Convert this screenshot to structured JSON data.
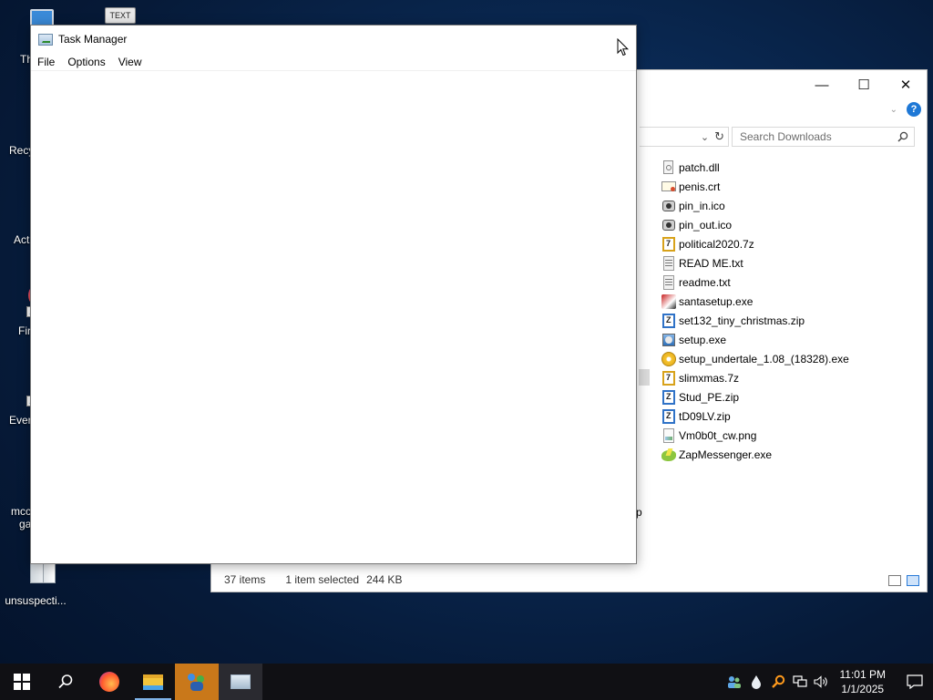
{
  "desktop": {
    "icons": [
      {
        "label": "Th",
        "icon": "this-pc-icon"
      },
      {
        "label": "TEXT",
        "icon": "text-document-icon"
      },
      {
        "label": "Recy",
        "icon": "recycle-bin-icon"
      },
      {
        "label": "Act",
        "icon": "document-icon"
      },
      {
        "label": "Fir",
        "icon": "firefox-icon"
      },
      {
        "label": "Ever",
        "icon": "everything-icon"
      },
      {
        "label": "mcc",
        "label2": "ga",
        "icon": "document-icon"
      },
      {
        "label": "unsuspecti...",
        "icon": "document-icon"
      }
    ]
  },
  "task_manager": {
    "title": "Task Manager",
    "menu": [
      "File",
      "Options",
      "View"
    ]
  },
  "explorer": {
    "caption": {
      "minimize": "—",
      "maximize": "☐",
      "close": "✕"
    },
    "search_placeholder": "Search Downloads",
    "files": [
      {
        "name": "patch.dll",
        "icon": "dll-icon"
      },
      {
        "name": "penis.crt",
        "icon": "certificate-icon"
      },
      {
        "name": "pin_in.ico",
        "icon": "ico-file-icon"
      },
      {
        "name": "pin_out.ico",
        "icon": "ico-file-icon"
      },
      {
        "name": "political2020.7z",
        "icon": "archive-7z-icon"
      },
      {
        "name": "READ ME.txt",
        "icon": "text-file-icon"
      },
      {
        "name": "readme.txt",
        "icon": "text-file-icon"
      },
      {
        "name": "santasetup.exe",
        "icon": "santa-exe-icon"
      },
      {
        "name": "set132_tiny_christmas.zip",
        "icon": "archive-zip-icon"
      },
      {
        "name": "setup.exe",
        "icon": "setup-exe-icon"
      },
      {
        "name": "setup_undertale_1.08_(18328).exe",
        "icon": "disc-exe-icon"
      },
      {
        "name": "slimxmas.7z",
        "icon": "archive-7z-icon"
      },
      {
        "name": "Stud_PE.zip",
        "icon": "archive-zip-icon"
      },
      {
        "name": "tD09LV.zip",
        "icon": "archive-zip-icon"
      },
      {
        "name": "Vm0b0t_cw.png",
        "icon": "image-file-icon"
      },
      {
        "name": "ZapMessenger.exe",
        "icon": "zap-exe-icon"
      }
    ],
    "partial_label": "p",
    "status": {
      "items": "37 items",
      "selected": "1 item selected",
      "size": "244 KB"
    }
  },
  "taskbar": {
    "buttons": [
      "start-icon",
      "search-icon",
      "firefox-icon",
      "file-explorer-icon",
      "network-app-icon",
      "task-manager-icon"
    ],
    "clock": {
      "time": "11:01 PM",
      "date": "1/1/2025"
    }
  }
}
